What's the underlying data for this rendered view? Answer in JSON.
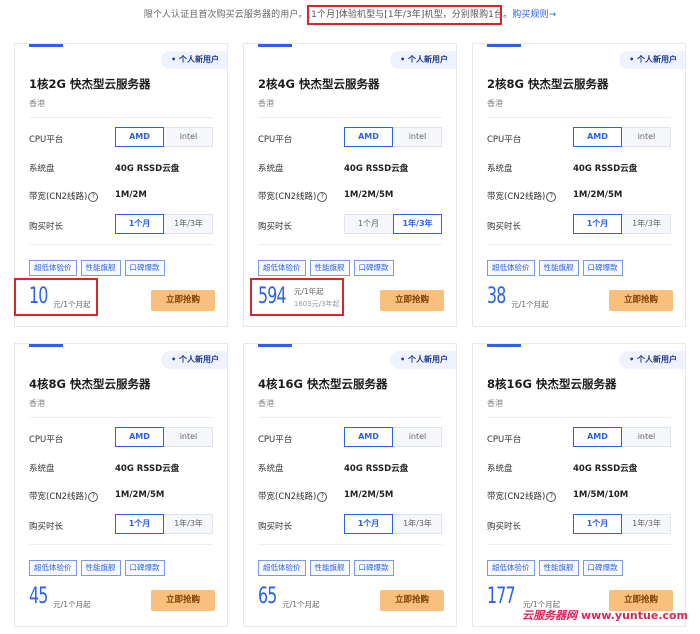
{
  "notice": {
    "pre": "限个人认证且首次购买云服务器的用户。",
    "highlight": "[1个月]体验机型与[1年/3年]机型，分别限购1台。",
    "rule_link": "购买规则→"
  },
  "labels": {
    "cpu": "CPU平台",
    "disk": "系统盘",
    "bandwidth": "带宽(CN2线路)",
    "help_glyph": "?",
    "period": "购买时长",
    "opt_amd": "AMD",
    "opt_intel": "intel",
    "opt_1m": "1个月",
    "opt_1y3y": "1年/3年",
    "tags": [
      "超低体验价",
      "性能旗舰",
      "口碑爆款"
    ],
    "buy": "立即抢购",
    "badge": "个人新用户"
  },
  "cards": [
    {
      "title": "1核2G 快杰型云服务器",
      "region": "香港",
      "disk": "40G RSSD云盘",
      "bandwidth": "1M/2M",
      "period_selected": "1个月",
      "price": "10",
      "price_unit": "元/1个月起",
      "price_sub": ""
    },
    {
      "title": "2核4G 快杰型云服务器",
      "region": "香港",
      "disk": "40G RSSD云盘",
      "bandwidth": "1M/2M/5M",
      "period_selected": "1年/3年",
      "price": "594",
      "price_unit": "元/1年起",
      "price_sub": "1603元/3年起"
    },
    {
      "title": "2核8G 快杰型云服务器",
      "region": "香港",
      "disk": "40G RSSD云盘",
      "bandwidth": "1M/2M/5M",
      "period_selected": "1个月",
      "price": "38",
      "price_unit": "元/1个月起",
      "price_sub": ""
    },
    {
      "title": "4核8G 快杰型云服务器",
      "region": "香港",
      "disk": "40G RSSD云盘",
      "bandwidth": "1M/2M/5M",
      "period_selected": "1个月",
      "price": "45",
      "price_unit": "元/1个月起",
      "price_sub": ""
    },
    {
      "title": "4核16G 快杰型云服务器",
      "region": "香港",
      "disk": "40G RSSD云盘",
      "bandwidth": "1M/2M/5M",
      "period_selected": "1个月",
      "price": "65",
      "price_unit": "元/1个月起",
      "price_sub": ""
    },
    {
      "title": "8核16G 快杰型云服务器",
      "region": "香港",
      "disk": "40G RSSD云盘",
      "bandwidth": "1M/5M/10M",
      "period_selected": "1个月",
      "price": "177",
      "price_unit": "元/1个月起",
      "price_sub": ""
    }
  ],
  "watermark": {
    "text": "云服务器网",
    "site": "www.yuntue.com"
  },
  "colors": {
    "accent": "#2b62e8",
    "buy_button": "#f8c07c",
    "highlight_box": "#d9262c"
  }
}
